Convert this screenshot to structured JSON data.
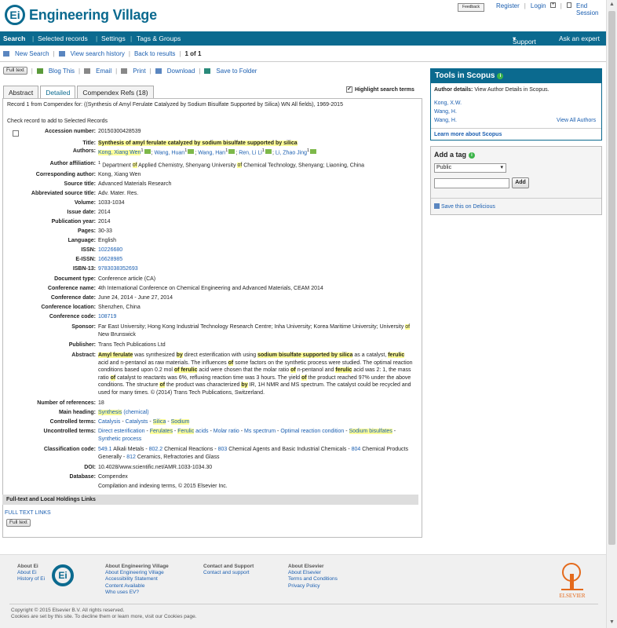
{
  "header": {
    "brand": "Engineering Village",
    "feedback": "Feedback",
    "links": [
      "Register",
      "Login",
      "End Session"
    ]
  },
  "nav": {
    "left": [
      "Search",
      "Selected records",
      "Settings",
      "Tags & Groups"
    ],
    "right": [
      "Support",
      "Ask an expert"
    ]
  },
  "actions": {
    "new_search": "New Search",
    "view_history": "View search history",
    "back": "Back to results",
    "pager": "1 of 1"
  },
  "toolbar": {
    "full_text": "Full text",
    "blog": "Blog This",
    "email": "Email",
    "print": "Print",
    "download": "Download",
    "save_folder": "Save to Folder"
  },
  "tabs": [
    "Abstract",
    "Detailed",
    "Compendex Refs (18)"
  ],
  "highlight_label": "Highlight search terms",
  "record_line": "Record 1 from Compendex for: ((Synthesis of Amyl Ferulate Catalyzed by Sodium Bisulfate Supported by Silica) WN All fields), 1969-2015",
  "check_record": "Check record to add to Selected Records",
  "fields": {
    "accession_label": "Accession number:",
    "accession": "20150300428539",
    "title_label": "Title:",
    "authors_label": "Authors:",
    "affiliation_label": "Author affiliation:",
    "corresponding_label": "Corresponding author:",
    "corresponding": "Kong, Xiang Wen",
    "source_label": "Source title:",
    "source": "Advanced Materials Research",
    "abbrev_label": "Abbreviated source title:",
    "abbrev": "Adv. Mater. Res.",
    "volume_label": "Volume:",
    "volume": "1033-1034",
    "issue_label": "Issue date:",
    "issue": "2014",
    "pubyear_label": "Publication year:",
    "pubyear": "2014",
    "pages_label": "Pages:",
    "pages": "30-33",
    "language_label": "Language:",
    "language": "English",
    "issn_label": "ISSN:",
    "issn": "10226680",
    "eissn_label": "E-ISSN:",
    "eissn": "16628985",
    "isbn_label": "ISBN-13:",
    "isbn": "9783038352693",
    "doctype_label": "Document type:",
    "doctype": "Conference article (CA)",
    "confname_label": "Conference name:",
    "confname": "4th International Conference on Chemical Engineering and Advanced Materials, CEAM 2014",
    "confdate_label": "Conference date:",
    "confdate": "June 24, 2014 - June 27, 2014",
    "confloc_label": "Conference location:",
    "confloc": "Shenzhen, China",
    "confcode_label": "Conference code:",
    "confcode": "108719",
    "sponsor_label": "Sponsor:",
    "publisher_label": "Publisher:",
    "publisher": "Trans Tech Publications Ltd",
    "abstract_label": "Abstract:",
    "numrefs_label": "Number of references:",
    "numrefs": "18",
    "mainheading_label": "Main heading:",
    "controlled_label": "Controlled terms:",
    "uncontrolled_label": "Uncontrolled terms:",
    "classification_label": "Classification code:",
    "doi_label": "DOI:",
    "doi": "10.4028/www.scientific.net/AMR.1033-1034.30",
    "database_label": "Database:",
    "database": "Compendex",
    "copyright": "Compilation and indexing terms, © 2015 Elsevier Inc."
  },
  "fulltext_section": "Full-text and Local Holdings Links",
  "fulltext_links": "FULL TEXT LINKS",
  "fulltext_btn": "Full text",
  "scopus": {
    "title": "Tools in Scopus",
    "details_label": "Author details:",
    "details_text": "View Author Details in Scopus.",
    "authors": [
      "Kong, X.W.",
      "Wang, H.",
      "Wang, H."
    ],
    "view_all": "View All Authors",
    "learn": "Learn more about Scopus"
  },
  "tag": {
    "title": "Add a tag",
    "select": "Public",
    "add": "Add",
    "delicious": "Save this on Delicious"
  },
  "footer": {
    "c1_head": "About Ei",
    "c1": [
      "About Ei",
      "History of Ei"
    ],
    "c2_head": "About Engineering Village",
    "c2": [
      "About Engineering Village",
      "Accessibility Statement",
      "Content Available",
      "Who uses EV?"
    ],
    "c3_head": "Contact and Support",
    "c3": [
      "Contact and support"
    ],
    "c4_head": "About Elsevier",
    "c4": [
      "About Elsevier",
      "Terms and Conditions",
      "Privacy Policy"
    ],
    "elsevier": "ELSEVIER",
    "copyright1": "Copyright © 2015 Elsevier B.V. All rights reserved.",
    "copyright2": "Cookies are set by this site. To decline them or learn more, visit our Cookies page."
  }
}
